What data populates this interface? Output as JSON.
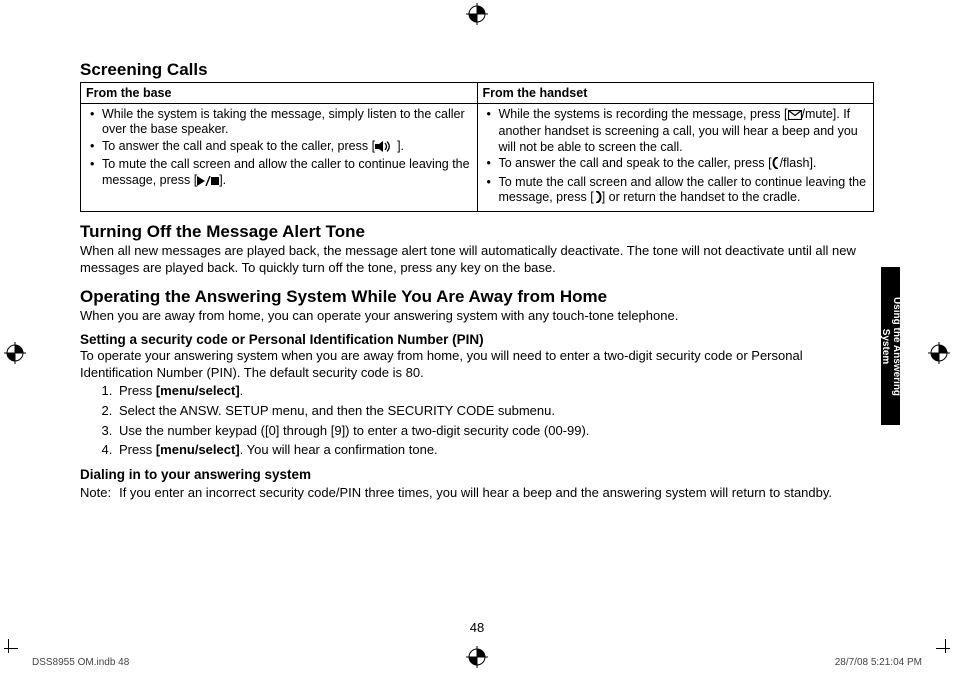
{
  "headings": {
    "h1": "Screening Calls",
    "th_base": "From the base",
    "th_handset": "From the handset",
    "h2": "Turning Off the Message Alert Tone",
    "h3": "Operating the Answering System While You Are Away from Home",
    "sub1": "Setting a security code or Personal Identification Number (PIN)",
    "sub2": "Dialing in to your answering system"
  },
  "table": {
    "base": {
      "b1": "While the system is taking the message, simply listen to the caller over the base speaker.",
      "b2a": "To answer the call and speak to the caller, press [",
      "b2b": "].",
      "b3a": "To mute the call screen and allow the caller to continue leaving the message, press [",
      "b3b": "]."
    },
    "handset": {
      "h1a": "While the systems is recording the message, press [",
      "h1b": "/mute]. If another handset is screening a call, you will hear a beep and you will not be able to screen the call.",
      "h2a": "To answer the call and speak to the caller, press [",
      "h2b": "/flash].",
      "h3a": "To mute the call screen and allow the caller to continue leaving the message, press [",
      "h3b": "] or return the handset to the cradle."
    }
  },
  "paragraphs": {
    "p_turnoff": "When all new messages are played back, the message alert tone will automatically deactivate. The tone will not deactivate until all new messages are played back. To quickly turn off the tone, press any key on the base.",
    "p_operate": "When you are away from home, you can operate your answering system with any touch-tone telephone.",
    "p_pin": "To operate your answering system when you are away from home, you will need to enter a two-digit security code or Personal Identification Number (PIN). The default security code is 80."
  },
  "steps": {
    "s1a": "Press ",
    "s1b": "[menu/select]",
    "s1c": ".",
    "s2": "Select the ANSW. SETUP menu, and then the SECURITY CODE submenu.",
    "s3": "Use the number keypad ([0] through [9]) to enter a two-digit security code (00-99).",
    "s4a": "Press ",
    "s4b": "[menu/select]",
    "s4c": ". You will hear a confirmation tone."
  },
  "note": {
    "label": "Note:",
    "text": "If you enter an incorrect security code/PIN three times, you will hear a beep and the answering system will return to standby."
  },
  "sidebar": "Using the Answering\nSystem",
  "page_number": "48",
  "footer": {
    "left": "DSS8955 OM.indb   48",
    "right": "28/7/08   5:21:04 PM"
  }
}
